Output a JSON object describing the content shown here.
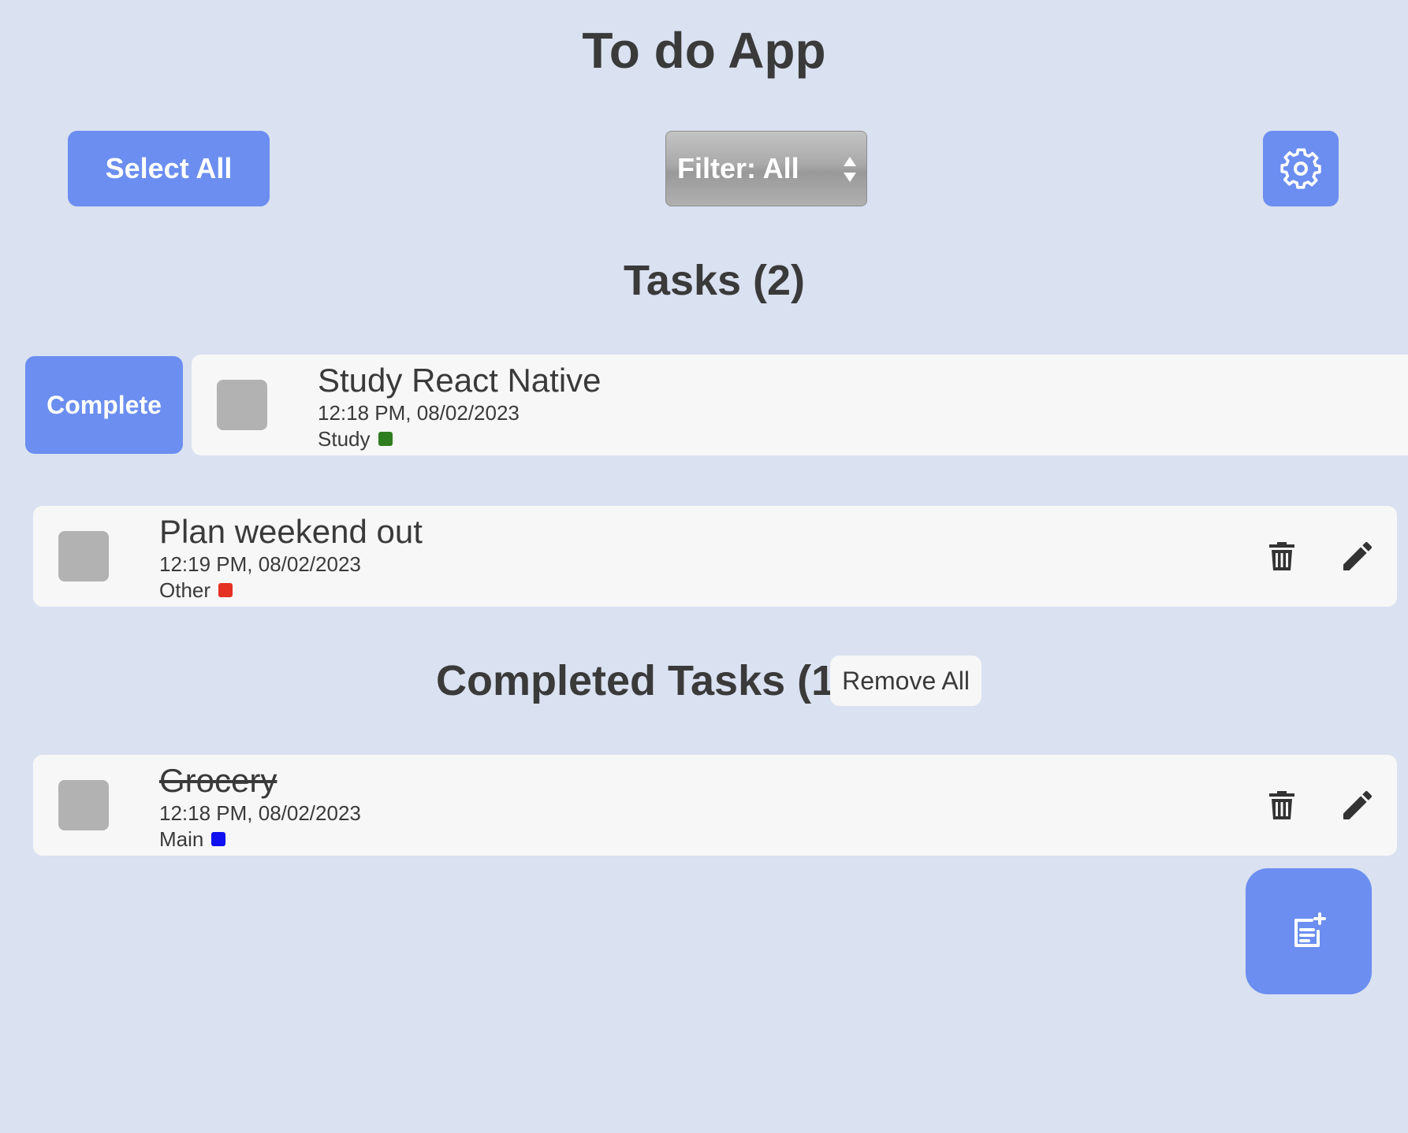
{
  "app": {
    "title": "To do App"
  },
  "toolbar": {
    "select_all_label": "Select All",
    "filter_label": "Filter: All",
    "settings_icon": "gear-icon"
  },
  "tasks_section": {
    "title": "Tasks (2)",
    "swipe_action_label": "Complete",
    "items": [
      {
        "title": "Study React Native",
        "time": "12:18 PM, 08/02/2023",
        "category": "Study",
        "category_color": "#2e7d1f"
      },
      {
        "title": "Plan weekend out",
        "time": "12:19 PM, 08/02/2023",
        "category": "Other",
        "category_color": "#e53024"
      }
    ]
  },
  "completed_section": {
    "title": "Completed Tasks (1)",
    "remove_all_label": "Remove All",
    "items": [
      {
        "title": "Grocery",
        "time": "12:18 PM, 08/02/2023",
        "category": "Main",
        "category_color": "#1010f0"
      }
    ]
  },
  "colors": {
    "background": "#dae1f0",
    "accent": "#6b8ef0",
    "card": "#f7f7f7",
    "checkbox": "#b2b2b2",
    "text": "#3a3a3a"
  },
  "fab": {
    "icon": "add-note-icon"
  }
}
